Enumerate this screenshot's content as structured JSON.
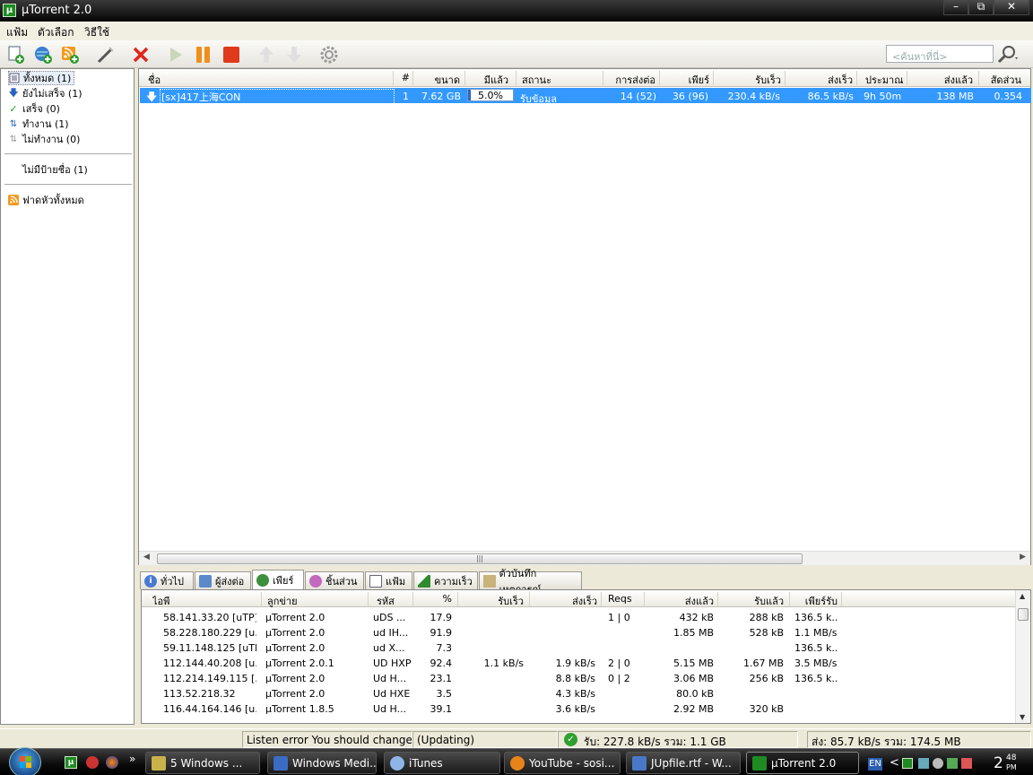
{
  "window": {
    "title": "µTorrent 2.0",
    "controls": [
      "minimize",
      "maximize",
      "close"
    ]
  },
  "menu": [
    "แฟ้ม",
    "ตัวเลือก",
    "วิธีใช้"
  ],
  "toolbar": {
    "buttons": [
      "add-torrent-icon",
      "add-url-icon",
      "add-rss-icon",
      "create-torrent-icon",
      "remove-icon",
      "start-icon",
      "pause-icon",
      "stop-icon",
      "move-up-icon",
      "move-down-icon",
      "preferences-icon"
    ],
    "search_placeholder": "<ค้นหาที่นี่>"
  },
  "sidebar": {
    "categories": [
      {
        "label": "ทั้งหมด (1)",
        "icon": "all-icon"
      },
      {
        "label": "ยังไม่เสร็จ (1)",
        "icon": "downloading-icon"
      },
      {
        "label": "เสร็จ (0)",
        "icon": "completed-icon"
      },
      {
        "label": "ทำงาน (1)",
        "icon": "active-icon"
      },
      {
        "label": "ไม่ทำงาน (0)",
        "icon": "inactive-icon"
      }
    ],
    "labels": [
      {
        "label": "ไม่มีป้ายชื่อ (1)"
      }
    ],
    "feeds": [
      {
        "label": "ฟาดหัวทั้งหมด",
        "icon": "rss-icon"
      }
    ]
  },
  "torrents": {
    "columns": [
      "ชื่อ",
      "#",
      "ขนาด",
      "มีแล้ว",
      "สถานะ",
      "การส่งต่อ",
      "เพียร์",
      "รับเร็ว",
      "ส่งเร็ว",
      "ประมาณ",
      "ส่งแล้ว",
      "สัดส่วน"
    ],
    "rows": [
      {
        "name": "[sx]417上海CON",
        "num": "1",
        "size": "7.62 GB",
        "done": "5.0%",
        "done_fraction": 0.05,
        "status": "รับข้อมูล",
        "seeds": "14 (52)",
        "peers": "36 (96)",
        "down": "230.4 kB/s",
        "up": "86.5 kB/s",
        "eta": "9h 50m",
        "uploaded": "138 MB",
        "ratio": "0.354"
      }
    ]
  },
  "tabs": [
    {
      "label": "ทั่วไป",
      "icon": "info-icon"
    },
    {
      "label": "ผู้ส่งต่อ",
      "icon": "trackers-icon"
    },
    {
      "label": "เพียร์",
      "icon": "peers-icon",
      "active": true
    },
    {
      "label": "ชิ้นส่วน",
      "icon": "pieces-icon"
    },
    {
      "label": "แฟ้ม",
      "icon": "files-icon"
    },
    {
      "label": "ความเร็ว",
      "icon": "speed-icon"
    },
    {
      "label": "ตัวบันทึกเหตุการณ์",
      "icon": "logger-icon"
    }
  ],
  "peers": {
    "columns": [
      "ไอพี",
      "ลูกข่าย",
      "รหัส",
      "%",
      "รับเร็ว",
      "ส่งเร็ว",
      "Reqs",
      "ส่งแล้ว",
      "รับแล้ว",
      "เพียร์รับ"
    ],
    "rows": [
      [
        "58.141.33.20 [uTP]",
        "µTorrent 2.0",
        "uDS ...",
        "17.9",
        "",
        "",
        "1 | 0",
        "432 kB",
        "288 kB",
        "136.5 k..."
      ],
      [
        "58.228.180.229 [u...",
        "µTorrent 2.0",
        "ud IH...",
        "91.9",
        "",
        "",
        "",
        "1.85 MB",
        "528 kB",
        "1.1 MB/s"
      ],
      [
        "59.11.148.125 [uTP]",
        "µTorrent 2.0",
        "ud X...",
        "7.3",
        "",
        "",
        "",
        "",
        "",
        "136.5 k..."
      ],
      [
        "112.144.40.208 [u...",
        "µTorrent 2.0.1",
        "UD HXP",
        "92.4",
        "1.1 kB/s",
        "1.9 kB/s",
        "2 | 0",
        "5.15 MB",
        "1.67 MB",
        "3.5 MB/s"
      ],
      [
        "112.214.149.115 [...",
        "µTorrent 2.0",
        "Ud H...",
        "23.1",
        "",
        "8.8 kB/s",
        "0 | 2",
        "3.06 MB",
        "256 kB",
        "136.5 k..."
      ],
      [
        "113.52.218.32",
        "µTorrent 2.0",
        "Ud HXE",
        "3.5",
        "",
        "4.3 kB/s",
        "",
        "80.0 kB",
        "",
        ""
      ],
      [
        "116.44.164.146 [u...",
        "µTorrent 1.8.5",
        "Ud H...",
        "39.1",
        "",
        "3.6 kB/s",
        "",
        "2.92 MB",
        "320 kB",
        ""
      ]
    ]
  },
  "statusbar": {
    "error": "Listen error  You should change",
    "update": "(Updating)",
    "down": "รับ: 227.8 kB/s รวม: 1.1 GB",
    "up": "ส่ง: 85.7 kB/s รวม: 174.5 MB"
  },
  "taskbar": {
    "items": [
      {
        "label": "5 Windows ...",
        "icon": "windows-explorer-icon"
      },
      {
        "label": "Windows Medi...",
        "icon": "media-player-icon"
      },
      {
        "label": "iTunes",
        "icon": "itunes-icon"
      },
      {
        "label": "YouTube - sosi...",
        "icon": "firefox-icon"
      },
      {
        "label": "JUpfile.rtf - W...",
        "icon": "wordpad-icon"
      },
      {
        "label": "µTorrent 2.0",
        "icon": "utorrent-icon",
        "active": true
      }
    ],
    "lang": "EN",
    "clock": "2",
    "clock_small": "48",
    "clock_ampm": "PM"
  },
  "colors": {
    "selection": "#3399ff",
    "titlebar": "#0a0a0a",
    "accent_green": "#1f8a22"
  }
}
